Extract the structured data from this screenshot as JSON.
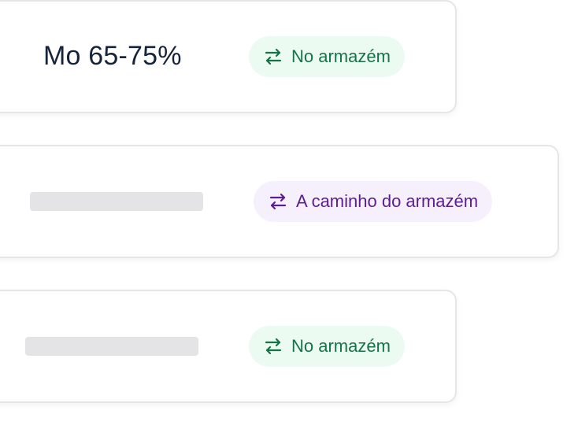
{
  "cards": [
    {
      "title": "Mo 65-75%",
      "status": {
        "label": "No armazém",
        "icon": "transfer-arrows-icon",
        "color": "#157347",
        "background": "#ecfbf1"
      }
    },
    {
      "title": "",
      "status": {
        "label": "A caminho do armazém",
        "icon": "transfer-arrows-icon",
        "color": "#5b1e8f",
        "background": "#f6f0fd"
      }
    },
    {
      "title": "",
      "status": {
        "label": "No armazém",
        "icon": "transfer-arrows-icon",
        "color": "#157347",
        "background": "#ecfbf1"
      }
    }
  ]
}
